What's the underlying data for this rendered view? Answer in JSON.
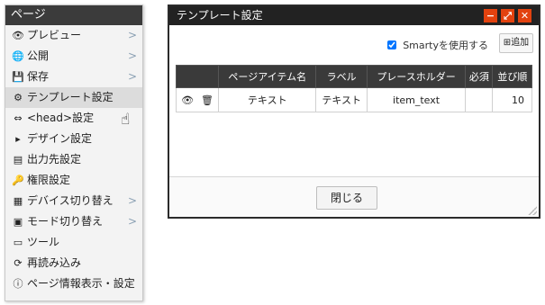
{
  "sidebar": {
    "header": "ページ",
    "items": [
      {
        "icon": "eye-icon",
        "glyph": "👁",
        "label": "プレビュー",
        "chevron": ">"
      },
      {
        "icon": "globe-icon",
        "glyph": "🌐",
        "label": "公開",
        "chevron": ">"
      },
      {
        "icon": "save-icon",
        "glyph": "💾",
        "label": "保存",
        "chevron": ">"
      },
      {
        "icon": "template-icon",
        "glyph": "⚙",
        "label": "テンプレート設定",
        "chevron": ""
      },
      {
        "icon": "code-icon",
        "glyph": "⇔",
        "label": "<head>設定",
        "chevron": ""
      },
      {
        "icon": "design-icon",
        "glyph": "▸",
        "label": "デザイン設定",
        "chevron": ""
      },
      {
        "icon": "output-icon",
        "glyph": "▤",
        "label": "出力先設定",
        "chevron": ""
      },
      {
        "icon": "key-icon",
        "glyph": "🔑",
        "label": "権限設定",
        "chevron": ""
      },
      {
        "icon": "device-icon",
        "glyph": "▦",
        "label": "デバイス切り替え",
        "chevron": ">"
      },
      {
        "icon": "mode-icon",
        "glyph": "▣",
        "label": "モード切り替え",
        "chevron": ">"
      },
      {
        "icon": "tool-icon",
        "glyph": "▭",
        "label": "ツール",
        "chevron": ""
      },
      {
        "icon": "reload-icon",
        "glyph": "⟳",
        "label": "再読み込み",
        "chevron": ""
      },
      {
        "icon": "info-icon",
        "glyph": "ⓘ",
        "label": "ページ情報表示・設定",
        "chevron": ""
      }
    ]
  },
  "dialog": {
    "title": "テンプレート設定",
    "buttons": {
      "minimize": "−",
      "maximize": "⤢",
      "close": "✕"
    },
    "smarty_label": "Smartyを使用する",
    "smarty_checked": true,
    "add_label": "追加",
    "columns": [
      "",
      "ページアイテム名",
      "ラベル",
      "プレースホルダー",
      "必須",
      "並び順"
    ],
    "rows": [
      {
        "name": "テキスト",
        "label": "テキスト",
        "placeholder": "item_text",
        "required": "",
        "order": "10"
      }
    ],
    "close_label": "閉じる"
  }
}
